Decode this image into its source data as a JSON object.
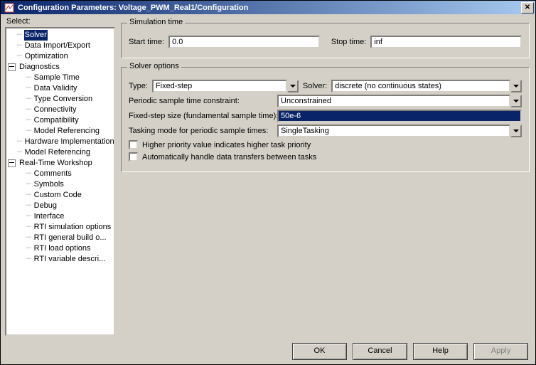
{
  "window": {
    "title": "Configuration Parameters: Voltage_PWM_Real1/Configuration"
  },
  "sidebar": {
    "label": "Select:",
    "items": [
      "Solver",
      "Data Import/Export",
      "Optimization",
      "Diagnostics",
      "Sample Time",
      "Data Validity",
      "Type Conversion",
      "Connectivity",
      "Compatibility",
      "Model Referencing",
      "Hardware Implementation",
      "Model Referencing",
      "Real-Time Workshop",
      "Comments",
      "Symbols",
      "Custom Code",
      "Debug",
      "Interface",
      "RTI simulation options",
      "RTI general build o...",
      "RTI load options",
      "RTI variable descri..."
    ]
  },
  "sim": {
    "legend": "Simulation time",
    "start_label": "Start time:",
    "start_value": "0.0",
    "stop_label": "Stop time:",
    "stop_value": "inf"
  },
  "solver": {
    "legend": "Solver options",
    "type_label": "Type:",
    "type_value": "Fixed-step",
    "solver_label": "Solver:",
    "solver_value": "discrete (no continuous states)",
    "periodic_label": "Periodic sample time constraint:",
    "periodic_value": "Unconstrained",
    "step_label": "Fixed-step size (fundamental sample time):",
    "step_value": "50e-6",
    "tasking_label": "Tasking mode for periodic sample times:",
    "tasking_value": "SingleTasking",
    "chk_priority": "Higher priority value indicates higher task priority",
    "chk_auto": "Automatically handle data transfers between tasks"
  },
  "buttons": {
    "ok": "OK",
    "cancel": "Cancel",
    "help": "Help",
    "apply": "Apply"
  }
}
